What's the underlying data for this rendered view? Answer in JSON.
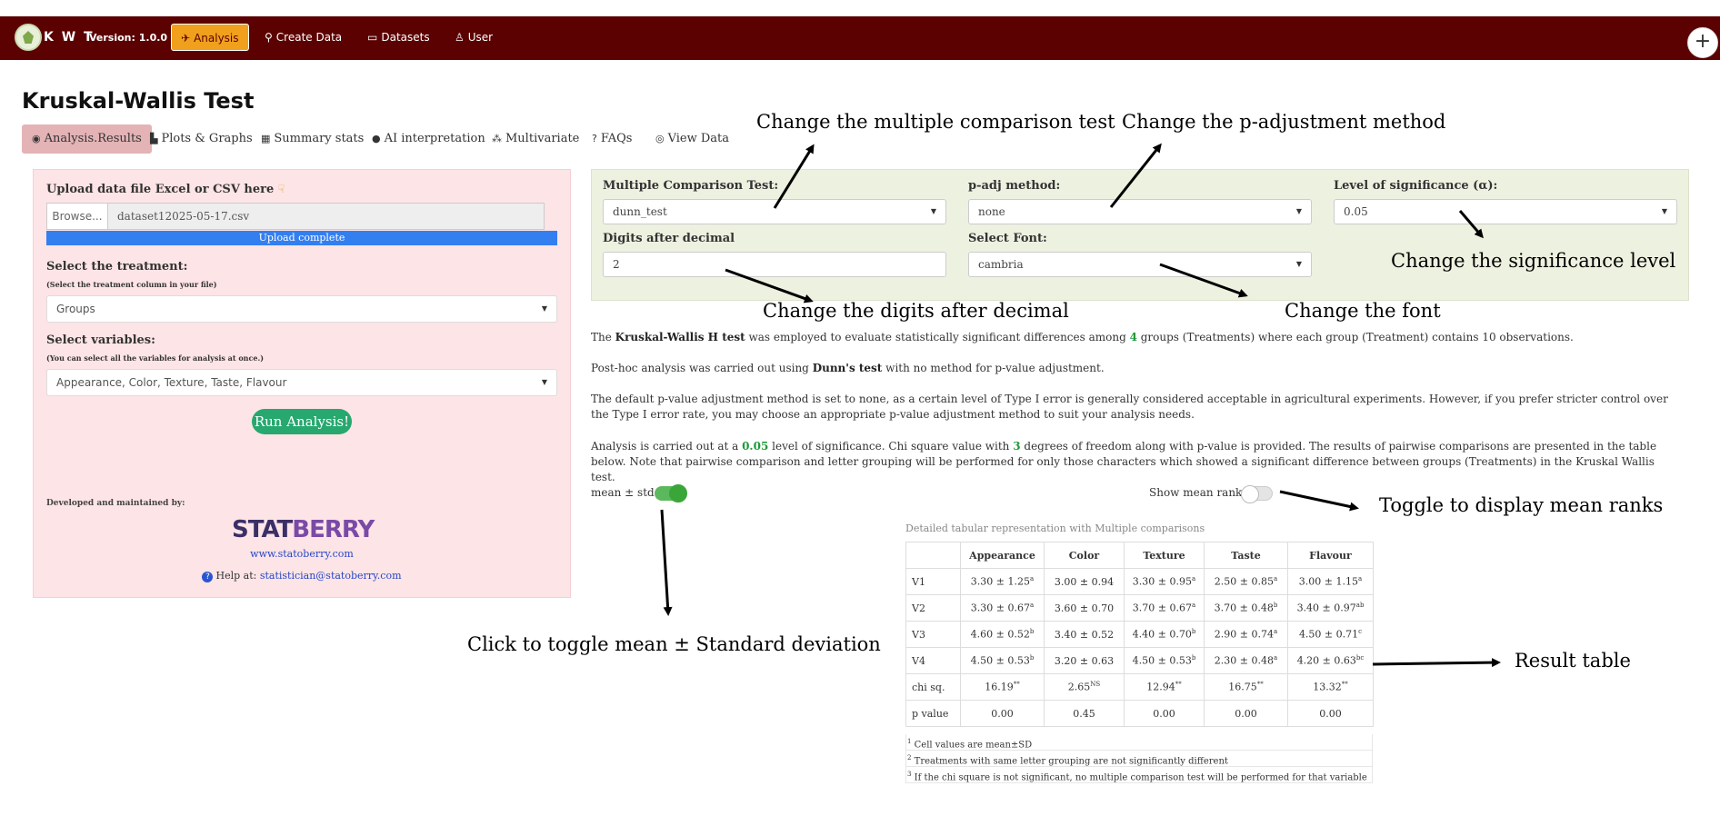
{
  "navbar": {
    "brand": "K W T",
    "version": "Version: 1.0.0",
    "items": [
      {
        "label": "Analysis",
        "icon": "paper-plane-icon"
      },
      {
        "label": "Create Data",
        "icon": "binoculars-icon"
      },
      {
        "label": "Datasets",
        "icon": "folder-open-icon"
      },
      {
        "label": "User",
        "icon": "user-icon"
      }
    ],
    "plus": "+"
  },
  "page": {
    "title": "Kruskal-Wallis Test",
    "tabs": [
      {
        "label": "Analysis.Results",
        "icon": "eye-icon"
      },
      {
        "label": "Plots & Graphs",
        "icon": "chart-icon"
      },
      {
        "label": "Summary stats",
        "icon": "table-icon"
      },
      {
        "label": "AI interpretation",
        "icon": "robot-icon"
      },
      {
        "label": "Multivariate",
        "icon": "cubes-icon"
      },
      {
        "label": "FAQs",
        "icon": "question-icon"
      },
      {
        "label": "View Data",
        "icon": "eye-icon"
      }
    ]
  },
  "left": {
    "upload_label": "Upload data file Excel or CSV here",
    "browse": "Browse...",
    "file_name": "dataset12025-05-17.csv",
    "upload_status": "Upload complete",
    "treatment_label": "Select the treatment:",
    "treatment_hint": "(Select the treatment column in your file)",
    "treatment_value": "Groups",
    "variables_label": "Select variables:",
    "variables_hint": "(You can select all the variables for analysis at once.)",
    "variables_value": "Appearance, Color, Texture, Taste, Flavour",
    "run_button": "Run Analysis!",
    "developed_by": "Developed and maintained by:",
    "logo_text_a": "STAT",
    "logo_text_b": "BERRY",
    "website": "www.statoberry.com",
    "help_label": "Help at:",
    "help_email": "statistician@statoberry.com"
  },
  "options": {
    "mct_label": "Multiple Comparison Test:",
    "mct_value": "dunn_test",
    "padj_label": "p-adj method:",
    "padj_value": "none",
    "alpha_label": "Level of significance (α):",
    "alpha_value": "0.05",
    "digits_label": "Digits after decimal",
    "digits_value": "2",
    "font_label": "Select Font:",
    "font_value": "cambria"
  },
  "text": {
    "p1_a": "The ",
    "p1_b": "Kruskal-Wallis H test",
    "p1_c": " was employed to evaluate statistically significant differences among ",
    "p1_n": "4",
    "p1_d": " groups (Treatments) where each group (Treatment) contains 10 observations.",
    "p2_a": "Post-hoc analysis was carried out using ",
    "p2_b": "Dunn's test",
    "p2_c": " with no method for p-value adjustment.",
    "p3": "The default p-value adjustment method is set to none, as a certain level of Type I error is generally considered acceptable in agricultural experiments. However, if you prefer stricter control over the Type I error rate, you may choose an appropriate p-value adjustment method to suit your analysis needs.",
    "p4_a": "Analysis is carried out at a ",
    "p4_alpha": "0.05",
    "p4_b": " level of significance. Chi square value with ",
    "p4_df": "3",
    "p4_c": " degrees of freedom along with p-value is provided. The results of pairwise comparisons are presented in the table below. Note that pairwise comparison and letter grouping will be performed for only those characters which showed a significant difference between groups (Treatments) in the Kruskal Wallis test."
  },
  "toggles": {
    "mean_std_label": "mean ± std",
    "mean_std_on": true,
    "mean_ranks_label": "Show mean ranks",
    "mean_ranks_on": false
  },
  "table": {
    "caption": "Detailed tabular representation with Multiple comparisons",
    "headers": [
      "",
      "Appearance",
      "Color",
      "Texture",
      "Taste",
      "Flavour"
    ],
    "rows": [
      {
        "label": "V1",
        "cells": [
          [
            "3.30 ± 1.25",
            "a"
          ],
          [
            "3.00 ± 0.94",
            ""
          ],
          [
            "3.30 ± 0.95",
            "a"
          ],
          [
            "2.50 ± 0.85",
            "a"
          ],
          [
            "3.00 ± 1.15",
            "a"
          ]
        ]
      },
      {
        "label": "V2",
        "cells": [
          [
            "3.30 ± 0.67",
            "a"
          ],
          [
            "3.60 ± 0.70",
            ""
          ],
          [
            "3.70 ± 0.67",
            "a"
          ],
          [
            "3.70 ± 0.48",
            "b"
          ],
          [
            "3.40 ± 0.97",
            "ab"
          ]
        ]
      },
      {
        "label": "V3",
        "cells": [
          [
            "4.60 ± 0.52",
            "b"
          ],
          [
            "3.40 ± 0.52",
            ""
          ],
          [
            "4.40 ± 0.70",
            "b"
          ],
          [
            "2.90 ± 0.74",
            "a"
          ],
          [
            "4.50 ± 0.71",
            "c"
          ]
        ]
      },
      {
        "label": "V4",
        "cells": [
          [
            "4.50 ± 0.53",
            "b"
          ],
          [
            "3.20 ± 0.63",
            ""
          ],
          [
            "4.50 ± 0.53",
            "b"
          ],
          [
            "2.30 ± 0.48",
            "a"
          ],
          [
            "4.20 ± 0.63",
            "bc"
          ]
        ]
      },
      {
        "label": "chi sq.",
        "cells": [
          [
            "16.19",
            "**"
          ],
          [
            "2.65",
            "NS"
          ],
          [
            "12.94",
            "**"
          ],
          [
            "16.75",
            "**"
          ],
          [
            "13.32",
            "**"
          ]
        ]
      },
      {
        "label": "p value",
        "cells": [
          [
            "0.00",
            ""
          ],
          [
            "0.45",
            ""
          ],
          [
            "0.00",
            ""
          ],
          [
            "0.00",
            ""
          ],
          [
            "0.00",
            ""
          ]
        ]
      }
    ],
    "footnotes": [
      {
        "n": "1",
        "text": "Cell values are mean±SD"
      },
      {
        "n": "2",
        "text": "Treatments with same letter grouping are not significantly different"
      },
      {
        "n": "3",
        "text": "If the chi square is not significant, no multiple comparison test will be performed for that variable"
      }
    ]
  },
  "annotations": {
    "mct": "Change the multiple comparison test",
    "padj": "Change the p-adjustment method",
    "sig": "Change the significance level",
    "digits": "Change the digits after decimal",
    "font": "Change the font",
    "ranks": "Toggle to display mean ranks",
    "meanstd": "Click to toggle mean ± Standard deviation",
    "result": "Result table"
  },
  "colors": {
    "navbar": "#5b0101",
    "active_nav": "#f0a01c",
    "left_panel": "#fde4e6",
    "options_panel": "#edf1e0",
    "run_button": "#26a86f",
    "upload_bar": "#337ff0",
    "highlight_number": "#1e9a3a"
  }
}
